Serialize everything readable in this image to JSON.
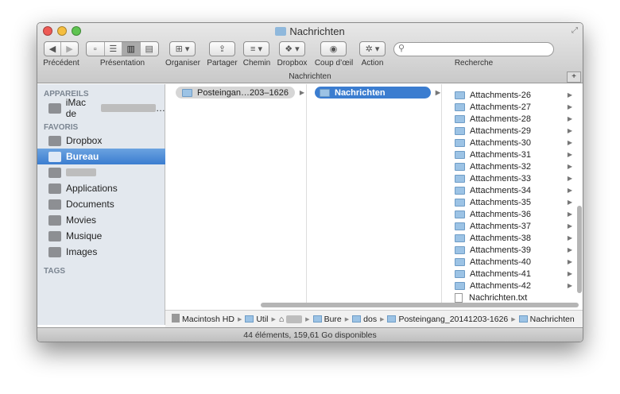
{
  "window": {
    "title": "Nachrichten"
  },
  "toolbar": {
    "back_label": "Précédent",
    "view_label": "Présentation",
    "arrange_label": "Organiser",
    "share_label": "Partager",
    "path_label": "Chemin",
    "dropbox_label": "Dropbox",
    "quicklook_label": "Coup d’œil",
    "action_label": "Action",
    "search_label": "Recherche",
    "search_placeholder": ""
  },
  "tab": {
    "title": "Nachrichten"
  },
  "sidebar": {
    "devices_header": "APPAREILS",
    "device": "iMac de",
    "favorites_header": "FAVORIS",
    "items": [
      {
        "label": "Dropbox"
      },
      {
        "label": "Bureau"
      },
      {
        "label": ""
      },
      {
        "label": "Applications"
      },
      {
        "label": "Documents"
      },
      {
        "label": "Movies"
      },
      {
        "label": "Musique"
      },
      {
        "label": "Images"
      }
    ],
    "tags_header": "TAGS"
  },
  "columns": {
    "col1": "Posteingan…203–1626",
    "col2": "Nachrichten",
    "col3": [
      "Attachments-26",
      "Attachments-27",
      "Attachments-28",
      "Attachments-29",
      "Attachments-30",
      "Attachments-31",
      "Attachments-32",
      "Attachments-33",
      "Attachments-34",
      "Attachments-35",
      "Attachments-36",
      "Attachments-37",
      "Attachments-38",
      "Attachments-39",
      "Attachments-40",
      "Attachments-41",
      "Attachments-42"
    ],
    "file": "Nachrichten.txt"
  },
  "pathbar": [
    "Macintosh HD",
    "Util",
    "",
    "Bure",
    "dos",
    "Posteingang_20141203-1626",
    "Nachrichten"
  ],
  "status": "44 éléments, 159,61 Go disponibles",
  "colors": {
    "selection": "#3b7dd0",
    "folder": "#9cc3e5"
  }
}
